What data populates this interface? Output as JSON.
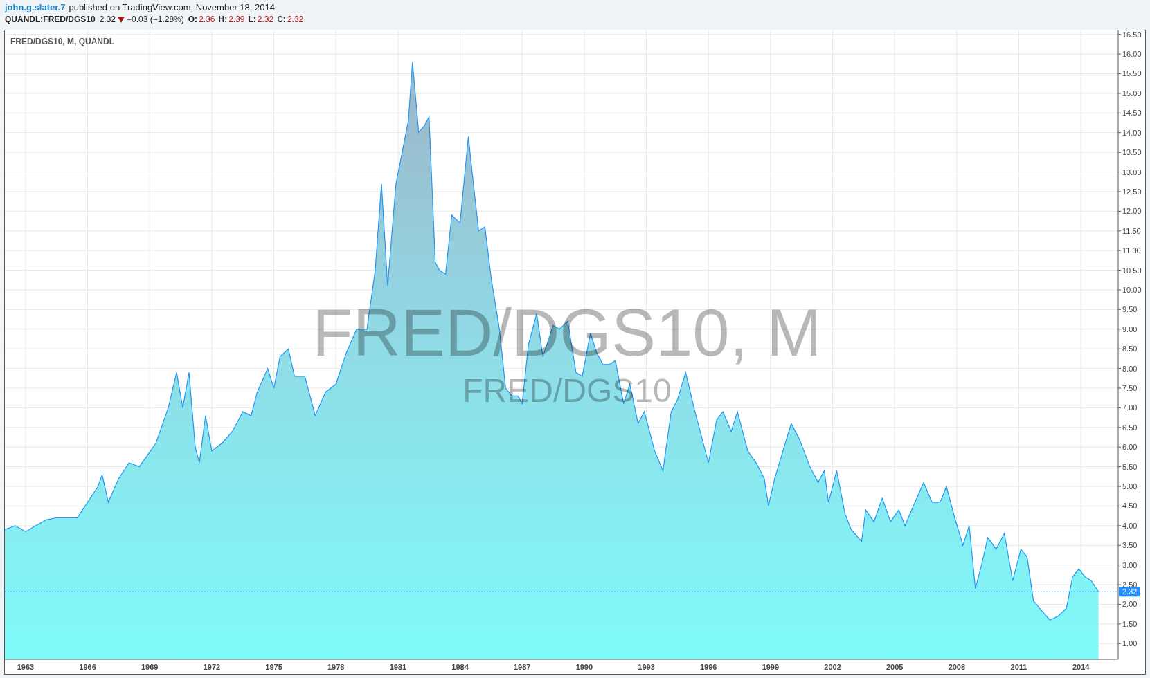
{
  "header": {
    "author": "john.g.slater.7",
    "published": "published on TradingView.com, November 18, 2014"
  },
  "quote": {
    "symbol": "QUANDL:FRED/DGS10",
    "last": "2.32",
    "down": true,
    "change": "−0.03 (−1.28%)",
    "ohlc": [
      {
        "label": "O:",
        "value": "2.36"
      },
      {
        "label": "H:",
        "value": "2.39"
      },
      {
        "label": "L:",
        "value": "2.32"
      },
      {
        "label": "C:",
        "value": "2.32"
      }
    ]
  },
  "chart": {
    "legend": "FRED/DGS10, M, QUANDL",
    "symbol_watermark": {
      "title": "FRED/DGS10, M",
      "subtitle": "FRED/DGS10"
    },
    "chart_data": {
      "type": "area",
      "xlim": [
        1962.0,
        2015.8
      ],
      "grid": true,
      "ylim": [
        0.6,
        16.6
      ],
      "x": [
        1962.0,
        1962.5,
        1963.0,
        1963.5,
        1964.0,
        1964.5,
        1965.0,
        1965.5,
        1966.0,
        1966.5,
        1966.7,
        1967.0,
        1967.5,
        1968.0,
        1968.5,
        1968.9,
        1969.3,
        1969.9,
        1970.3,
        1970.6,
        1970.9,
        1971.2,
        1971.4,
        1971.7,
        1972.0,
        1972.5,
        1973.0,
        1973.5,
        1973.9,
        1974.2,
        1974.7,
        1975.0,
        1975.3,
        1975.7,
        1976.0,
        1976.5,
        1977.0,
        1977.5,
        1978.0,
        1978.5,
        1979.0,
        1979.5,
        1979.9,
        1980.2,
        1980.5,
        1980.9,
        1981.2,
        1981.5,
        1981.7,
        1982.0,
        1982.3,
        1982.5,
        1982.8,
        1983.0,
        1983.3,
        1983.6,
        1984.0,
        1984.4,
        1984.6,
        1984.9,
        1985.2,
        1985.5,
        1985.9,
        1986.2,
        1986.5,
        1986.8,
        1987.0,
        1987.3,
        1987.7,
        1988.0,
        1988.5,
        1988.8,
        1989.2,
        1989.6,
        1989.9,
        1990.3,
        1990.6,
        1990.9,
        1991.2,
        1991.5,
        1991.9,
        1992.2,
        1992.6,
        1992.9,
        1993.4,
        1993.8,
        1994.2,
        1994.5,
        1994.9,
        1995.3,
        1995.7,
        1996.0,
        1996.4,
        1996.7,
        1997.1,
        1997.4,
        1997.9,
        1998.3,
        1998.7,
        1998.9,
        1999.2,
        1999.6,
        2000.0,
        2000.4,
        2000.9,
        2001.3,
        2001.6,
        2001.8,
        2002.2,
        2002.6,
        2002.9,
        2003.4,
        2003.6,
        2004.0,
        2004.4,
        2004.8,
        2005.2,
        2005.5,
        2005.9,
        2006.4,
        2006.8,
        2007.2,
        2007.5,
        2007.9,
        2008.3,
        2008.6,
        2008.9,
        2009.2,
        2009.5,
        2009.9,
        2010.3,
        2010.7,
        2011.1,
        2011.4,
        2011.7,
        2012.0,
        2012.5,
        2012.9,
        2013.3,
        2013.6,
        2013.9,
        2014.2,
        2014.5,
        2014.85
      ],
      "series": [
        {
          "color": "#2196f3",
          "values": [
            3.9,
            4.0,
            3.85,
            4.0,
            4.15,
            4.2,
            4.2,
            4.2,
            4.6,
            5.0,
            5.3,
            4.6,
            5.2,
            5.6,
            5.5,
            5.8,
            6.1,
            7.0,
            7.9,
            7.0,
            7.9,
            6.0,
            5.6,
            6.8,
            5.9,
            6.1,
            6.4,
            6.9,
            6.8,
            7.4,
            8.0,
            7.5,
            8.3,
            8.5,
            7.8,
            7.8,
            6.8,
            7.4,
            7.6,
            8.4,
            9.0,
            9.0,
            10.5,
            12.7,
            10.1,
            12.7,
            13.5,
            14.3,
            15.8,
            14.0,
            14.2,
            14.4,
            10.7,
            10.5,
            10.4,
            11.9,
            11.7,
            13.9,
            12.9,
            11.5,
            11.6,
            10.3,
            9.0,
            7.5,
            7.3,
            7.3,
            7.1,
            8.6,
            9.4,
            8.3,
            9.1,
            9.0,
            9.2,
            7.9,
            7.8,
            8.9,
            8.4,
            8.1,
            8.1,
            8.2,
            7.1,
            7.6,
            6.6,
            6.9,
            5.9,
            5.4,
            6.9,
            7.2,
            7.9,
            7.0,
            6.2,
            5.6,
            6.7,
            6.9,
            6.4,
            6.9,
            5.9,
            5.6,
            5.2,
            4.5,
            5.2,
            5.9,
            6.6,
            6.2,
            5.5,
            5.1,
            5.4,
            4.6,
            5.4,
            4.3,
            3.9,
            3.6,
            4.4,
            4.1,
            4.7,
            4.1,
            4.4,
            4.0,
            4.5,
            5.1,
            4.6,
            4.6,
            5.0,
            4.2,
            3.5,
            4.0,
            2.4,
            3.0,
            3.7,
            3.4,
            3.8,
            2.6,
            3.4,
            3.2,
            2.1,
            1.9,
            1.6,
            1.7,
            1.9,
            2.7,
            2.9,
            2.7,
            2.6,
            2.32
          ]
        }
      ],
      "xticks": [
        {
          "value": 1963,
          "label": "1963"
        },
        {
          "value": 1966,
          "label": "1966"
        },
        {
          "value": 1969,
          "label": "1969"
        },
        {
          "value": 1972,
          "label": "1972"
        },
        {
          "value": 1975,
          "label": "1975"
        },
        {
          "value": 1978,
          "label": "1978"
        },
        {
          "value": 1981,
          "label": "1981"
        },
        {
          "value": 1984,
          "label": "1984"
        },
        {
          "value": 1987,
          "label": "1987"
        },
        {
          "value": 1990,
          "label": "1990"
        },
        {
          "value": 1993,
          "label": "1993"
        },
        {
          "value": 1996,
          "label": "1996"
        },
        {
          "value": 1999,
          "label": "1999"
        },
        {
          "value": 2002,
          "label": "2002"
        },
        {
          "value": 2005,
          "label": "2005"
        },
        {
          "value": 2008,
          "label": "2008"
        },
        {
          "value": 2011,
          "label": "2011"
        },
        {
          "value": 2014,
          "label": "2014"
        }
      ],
      "yticks": [
        {
          "value": 1,
          "label": "1.00"
        },
        {
          "value": 1.5,
          "label": "1.50"
        },
        {
          "value": 2,
          "label": "2.00"
        },
        {
          "value": 2.5,
          "label": "2.50"
        },
        {
          "value": 3,
          "label": "3.00"
        },
        {
          "value": 3.5,
          "label": "3.50"
        },
        {
          "value": 4,
          "label": "4.00"
        },
        {
          "value": 4.5,
          "label": "4.50"
        },
        {
          "value": 5,
          "label": "5.00"
        },
        {
          "value": 5.5,
          "label": "5.50"
        },
        {
          "value": 6,
          "label": "6.00"
        },
        {
          "value": 6.5,
          "label": "6.50"
        },
        {
          "value": 7,
          "label": "7.00"
        },
        {
          "value": 7.5,
          "label": "7.50"
        },
        {
          "value": 8,
          "label": "8.00"
        },
        {
          "value": 8.5,
          "label": "8.50"
        },
        {
          "value": 9,
          "label": "9.00"
        },
        {
          "value": 9.5,
          "label": "9.50"
        },
        {
          "value": 10,
          "label": "10.00"
        },
        {
          "value": 10.5,
          "label": "10.50"
        },
        {
          "value": 11,
          "label": "11.00"
        },
        {
          "value": 11.5,
          "label": "11.50"
        },
        {
          "value": 12,
          "label": "12.00"
        },
        {
          "value": 12.5,
          "label": "12.50"
        },
        {
          "value": 13,
          "label": "13.00"
        },
        {
          "value": 13.5,
          "label": "13.50"
        },
        {
          "value": 14,
          "label": "14.00"
        },
        {
          "value": 14.5,
          "label": "14.50"
        },
        {
          "value": 15,
          "label": "15.00"
        },
        {
          "value": 15.5,
          "label": "15.50"
        },
        {
          "value": 16,
          "label": "16.00"
        },
        {
          "value": 16.5,
          "label": "16.50"
        }
      ],
      "ref_lines": [
        {
          "axis": "y",
          "value": 2.32,
          "label": "2.32",
          "color": "#1e90ff"
        }
      ]
    }
  }
}
